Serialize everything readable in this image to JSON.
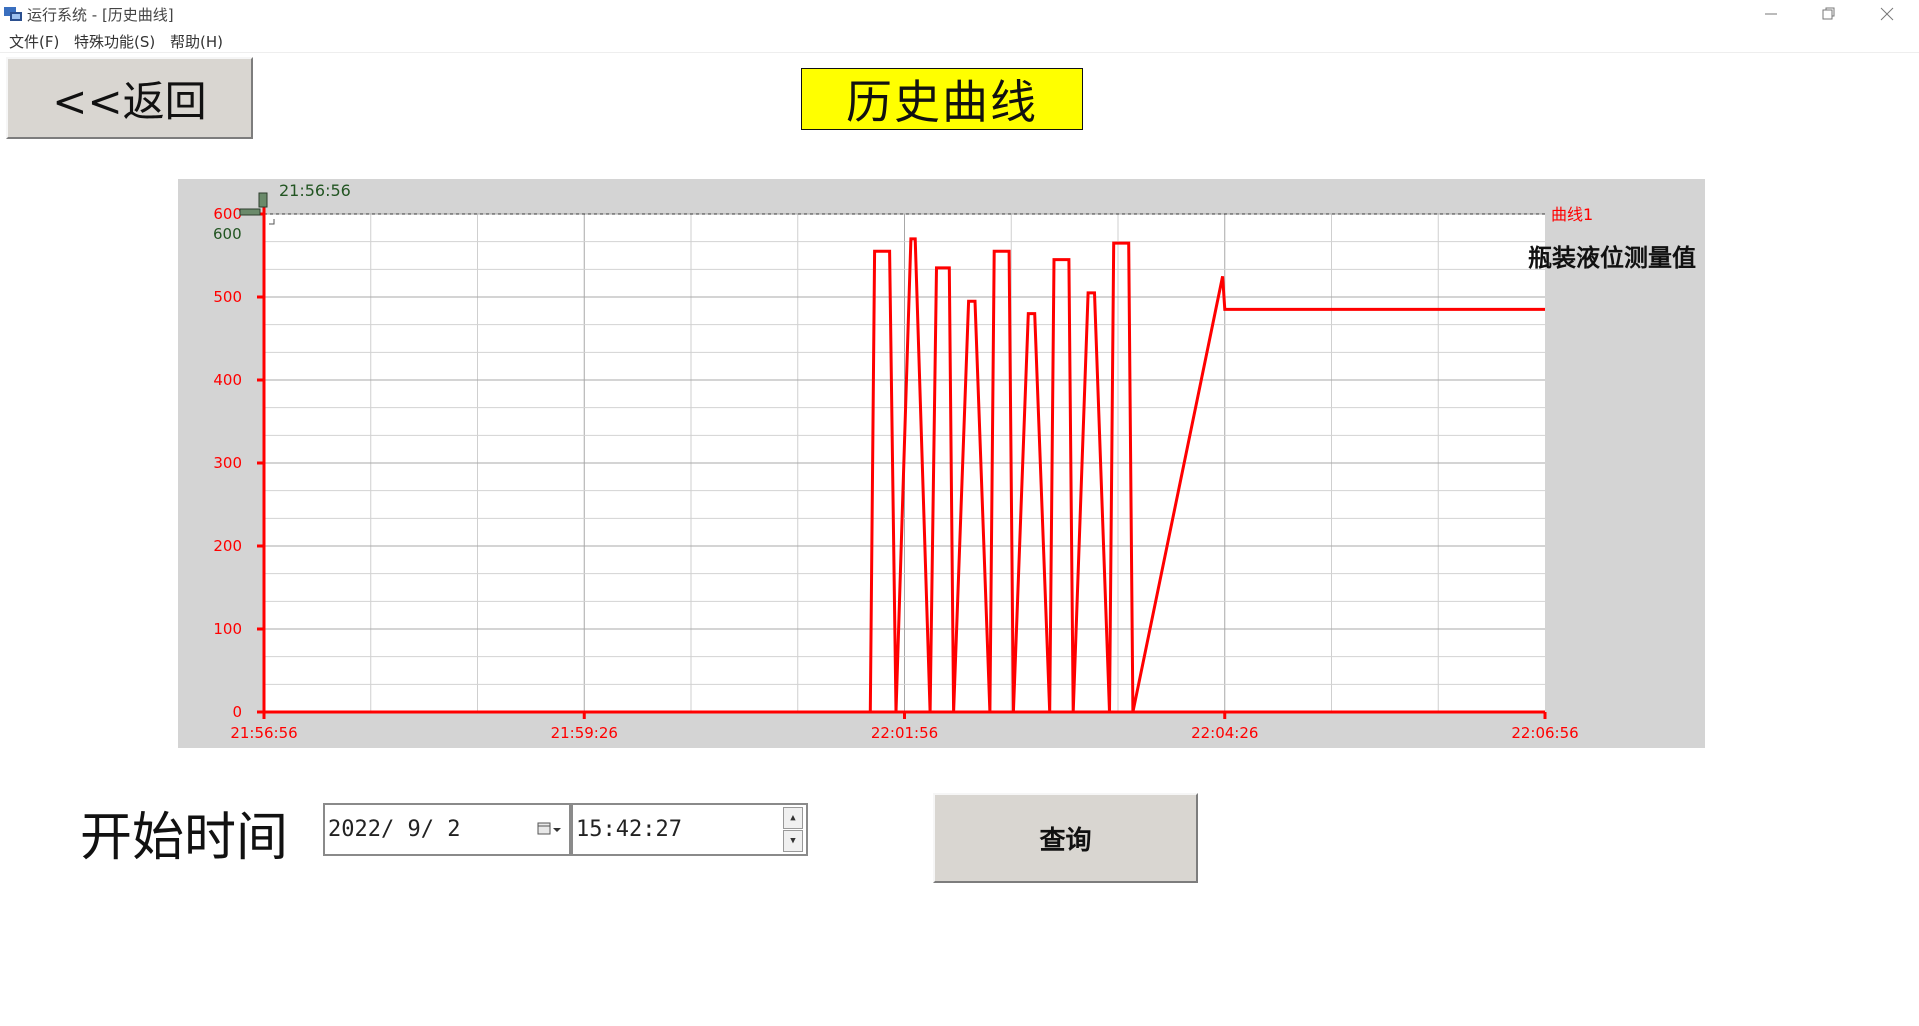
{
  "window": {
    "title": "运行系统 - [历史曲线]",
    "minimize_icon": "minimize-icon",
    "restore_icon": "restore-icon",
    "close_icon": "close-icon"
  },
  "menu": {
    "items": [
      {
        "label": "文件(F)"
      },
      {
        "label": "特殊功能(S)"
      },
      {
        "label": "帮助(H)"
      }
    ]
  },
  "toolbar": {
    "back_label": "<<返回",
    "page_title": "历史曲线"
  },
  "chart_data": {
    "type": "line",
    "cursor_time": "21:56:56",
    "cursor_value_label": "600",
    "series": [
      {
        "name": "曲线1",
        "color": "#ff0000",
        "description_label": "瓶装液位测量值",
        "x": [
          "21:56:56",
          "22:01:40",
          "22:01:42",
          "22:01:49",
          "22:01:52",
          "22:01:59",
          "22:02:01",
          "22:02:08",
          "22:02:11",
          "22:02:17",
          "22:02:19",
          "22:02:26",
          "22:02:29",
          "22:02:36",
          "22:02:38",
          "22:02:45",
          "22:02:47",
          "22:02:54",
          "22:02:57",
          "22:03:04",
          "22:03:06",
          "22:03:13",
          "22:03:15",
          "22:03:22",
          "22:03:25",
          "22:03:32",
          "22:03:34",
          "22:03:41",
          "22:03:43",
          "22:04:25",
          "22:04:26",
          "22:06:56"
        ],
        "values": [
          0,
          0,
          555,
          555,
          0,
          570,
          570,
          0,
          535,
          535,
          0,
          495,
          495,
          0,
          555,
          555,
          0,
          480,
          480,
          0,
          545,
          545,
          0,
          505,
          505,
          0,
          565,
          565,
          0,
          525,
          485,
          485
        ]
      }
    ],
    "xaxis": {
      "ticks": [
        "21:56:56",
        "21:59:26",
        "22:01:56",
        "22:04:26",
        "22:06:56"
      ],
      "range": [
        "21:56:56",
        "22:06:56"
      ]
    },
    "yaxis": {
      "ticks": [
        "0",
        "100",
        "200",
        "300",
        "400",
        "500",
        "600"
      ],
      "range": [
        0,
        600
      ]
    },
    "grid": true,
    "legend": "top-right"
  },
  "query": {
    "start_label": "开始时间",
    "date_value": "2022/ 9/ 2",
    "time_value": "15:42:27",
    "query_button": "查询"
  }
}
